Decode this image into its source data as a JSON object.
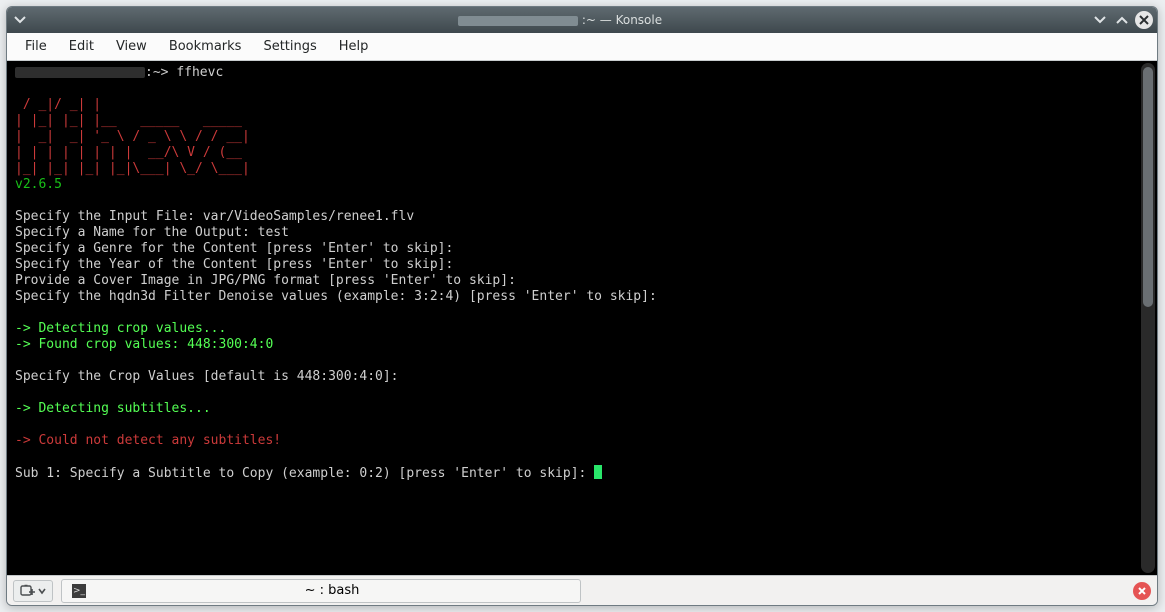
{
  "window": {
    "title_suffix": ":~ — Konsole"
  },
  "menu": {
    "file": "File",
    "edit": "Edit",
    "view": "View",
    "bookmarks": "Bookmarks",
    "settings": "Settings",
    "help": "Help"
  },
  "prompt": {
    "path": ":~>",
    "command": "ffhevc"
  },
  "ascii": {
    "l1": " / _|/ _| |",
    "l2": "| |_| |_| |__   _____   _____",
    "l3": "|  _|  _| '_ \\ / _ \\ \\ / / __|",
    "l4": "| | | | | | | |  __/\\ V / (__",
    "l5": "|_| |_| |_| |_|\\___| \\_/ \\___|"
  },
  "app": {
    "version": "v2.6.5"
  },
  "lines": {
    "input_file": "Specify the Input File: var/VideoSamples/renee1.flv",
    "output_name": "Specify a Name for the Output: test",
    "genre": "Specify a Genre for the Content [press 'Enter' to skip]:",
    "year": "Specify the Year of the Content [press 'Enter' to skip]:",
    "cover": "Provide a Cover Image in JPG/PNG format [press 'Enter' to skip]:",
    "denoise": "Specify the hqdn3d Filter Denoise values (example: 3:2:4) [press 'Enter' to skip]:",
    "detect_crop": "-> Detecting crop values...",
    "found_crop": "-> Found crop values: 448:300:4:0",
    "crop_prompt": "Specify the Crop Values [default is 448:300:4:0]:",
    "detect_subs": "-> Detecting subtitles...",
    "no_subs": "-> Could not detect any subtitles!",
    "sub1": "Sub 1: Specify a Subtitle to Copy (example: 0:2) [press 'Enter' to skip]: "
  },
  "tab": {
    "label": "~ : bash"
  }
}
